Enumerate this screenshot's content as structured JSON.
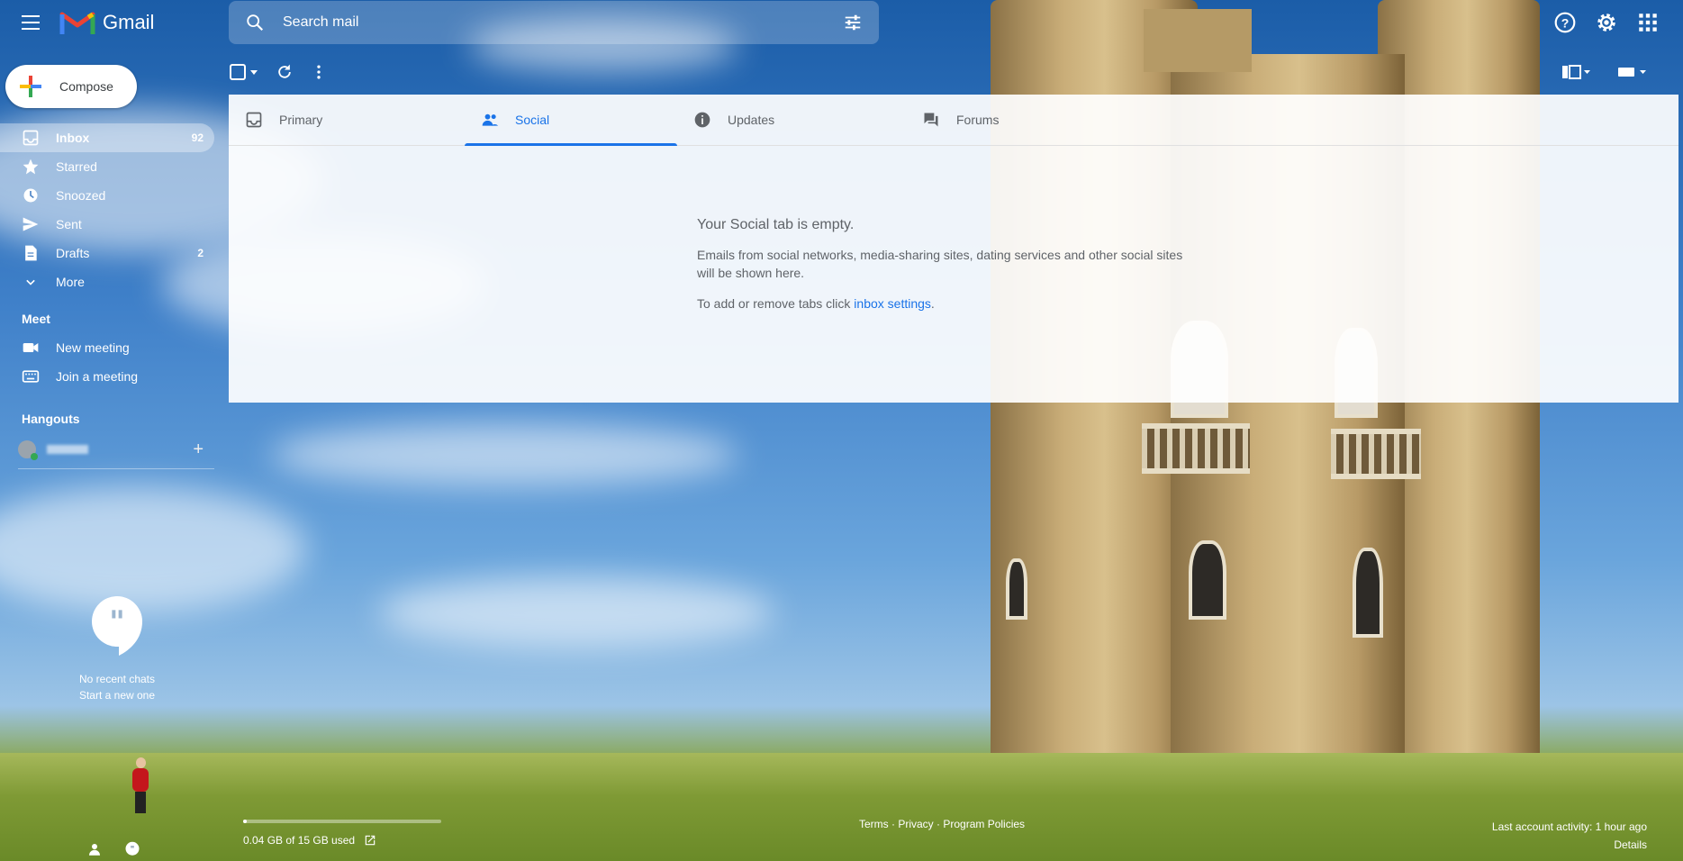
{
  "app": {
    "name": "Gmail"
  },
  "search": {
    "placeholder": "Search mail"
  },
  "compose": {
    "label": "Compose"
  },
  "nav": {
    "items": [
      {
        "label": "Inbox",
        "count": "92"
      },
      {
        "label": "Starred",
        "count": ""
      },
      {
        "label": "Snoozed",
        "count": ""
      },
      {
        "label": "Sent",
        "count": ""
      },
      {
        "label": "Drafts",
        "count": "2"
      },
      {
        "label": "More",
        "count": ""
      }
    ]
  },
  "meet": {
    "title": "Meet",
    "items": [
      {
        "label": "New meeting"
      },
      {
        "label": "Join a meeting"
      }
    ]
  },
  "hangouts": {
    "title": "Hangouts",
    "no_chats": "No recent chats",
    "start_new": "Start a new one"
  },
  "tabs": [
    {
      "label": "Primary"
    },
    {
      "label": "Social"
    },
    {
      "label": "Updates"
    },
    {
      "label": "Forums"
    }
  ],
  "empty_state": {
    "title": "Your Social tab is empty.",
    "description": "Emails from social networks, media-sharing sites, dating services and other social sites will be shown here.",
    "settings_prefix": "To add or remove tabs click ",
    "settings_link": "inbox settings",
    "settings_suffix": "."
  },
  "footer": {
    "storage_text": "0.04 GB of 15 GB used",
    "storage_fraction": 0.003,
    "links": [
      "Terms",
      "Privacy",
      "Program Policies"
    ],
    "separator": " · ",
    "last_activity": "Last account activity: 1 hour ago",
    "details": "Details"
  },
  "colors": {
    "accent": "#1a73e8",
    "online": "#34a853"
  }
}
